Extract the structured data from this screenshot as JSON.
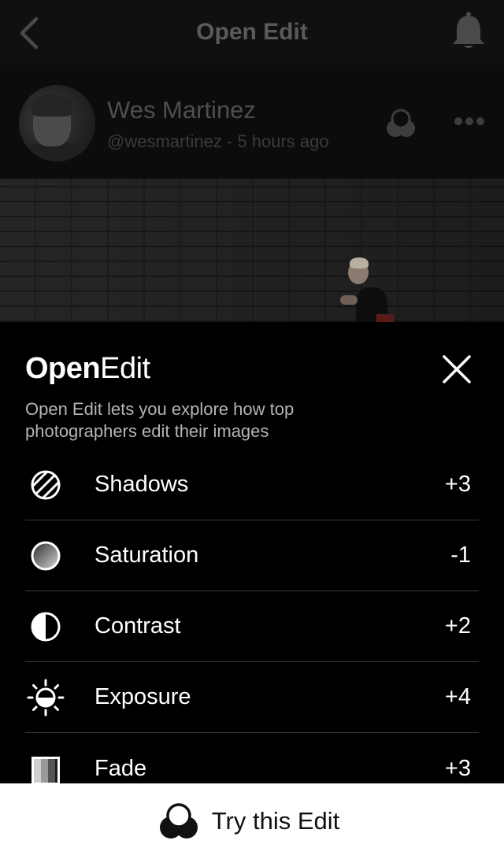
{
  "nav": {
    "title": "Open Edit",
    "back_icon": "chevron-left-icon",
    "notification_icon": "bell-icon"
  },
  "post": {
    "user_name": "Wes Martinez",
    "meta": "@wesmartinez - 5 hours ago",
    "edit_icon": "vsco-edit-icon",
    "more_icon": "more-dots-icon"
  },
  "sheet": {
    "title_bold": "Open",
    "title_light": "Edit",
    "description": "Open Edit lets you explore how top photographers edit their images",
    "close_icon": "close-icon",
    "adjustments": [
      {
        "icon": "shadows-icon",
        "label": "Shadows",
        "value": "+3"
      },
      {
        "icon": "saturation-icon",
        "label": "Saturation",
        "value": "-1"
      },
      {
        "icon": "contrast-icon",
        "label": "Contrast",
        "value": "+2"
      },
      {
        "icon": "exposure-icon",
        "label": "Exposure",
        "value": "+4"
      },
      {
        "icon": "fade-icon",
        "label": "Fade",
        "value": "+3"
      }
    ]
  },
  "action": {
    "label": "Try this Edit",
    "icon": "vsco-edit-icon"
  },
  "colors": {
    "background": "#000000",
    "action_bar": "#ffffff",
    "divider": "#3c3c3c",
    "dim_text": "#4e4e4e"
  }
}
